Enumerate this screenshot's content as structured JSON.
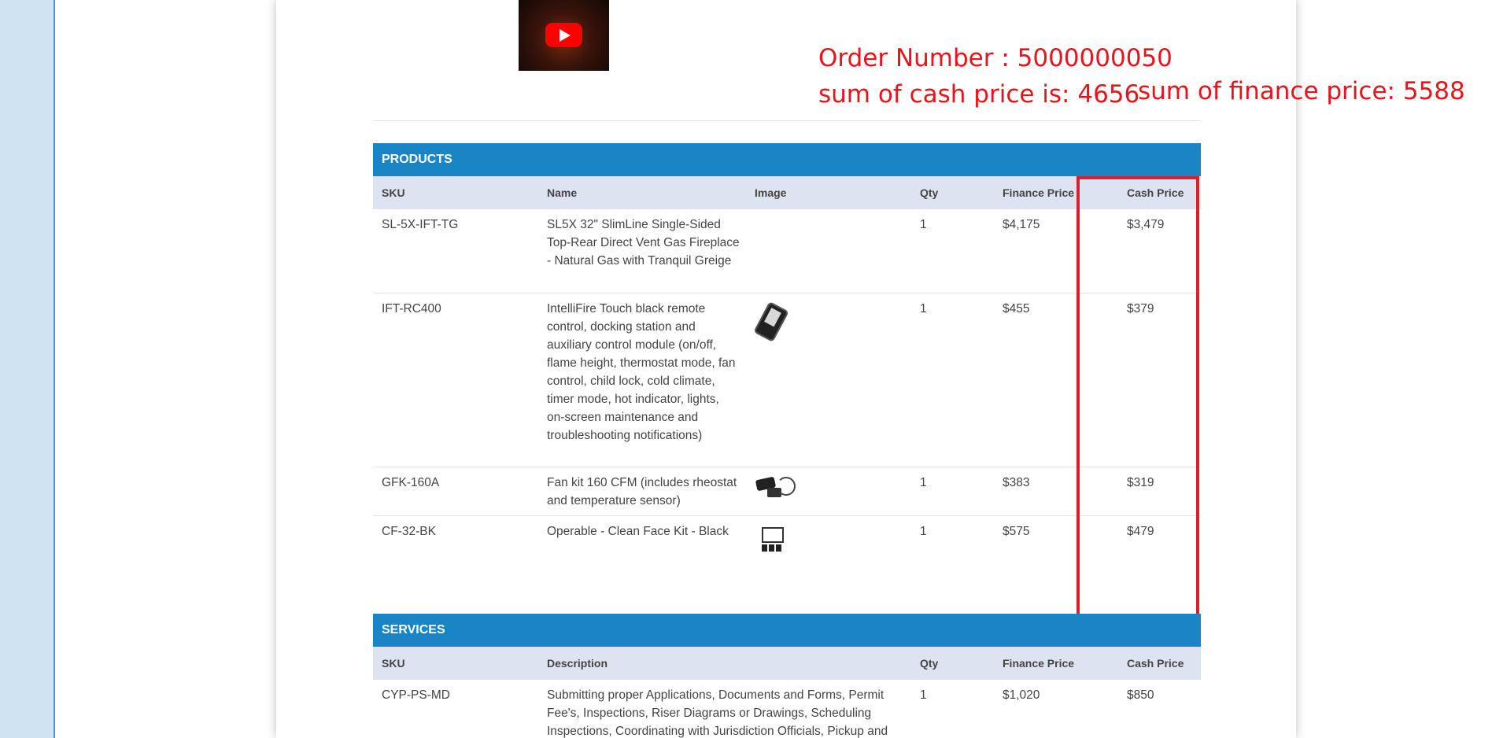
{
  "annotations": {
    "order_number": "Order Number : 5000000050",
    "cash_sum": "sum of cash price is: 4656",
    "finance_sum": "sum of finance price: 5588",
    "highlight_color": "#d9202c"
  },
  "video": {
    "icon": "youtube-play-icon"
  },
  "products": {
    "heading": "PRODUCTS",
    "columns": [
      "SKU",
      "Name",
      "Image",
      "Qty",
      "Finance Price",
      "Cash Price"
    ],
    "rows": [
      {
        "sku": "SL-5X-IFT-TG",
        "name": "SL5X 32\" SlimLine Single-Sided Top-Rear Direct Vent Gas Fireplace - Natural Gas with Tranquil Greige",
        "image": "",
        "qty": "1",
        "finance": "$4,175",
        "cash": "$3,479"
      },
      {
        "sku": "IFT-RC400",
        "name": "IntelliFire Touch black remote control, docking station and auxiliary control module (on/off, flame height, thermostat mode, fan control, child lock, cold climate, timer mode, hot indicator, lights, on-screen maintenance and troubleshooting notifications)",
        "image": "remote-control-image",
        "qty": "1",
        "finance": "$455",
        "cash": "$379"
      },
      {
        "sku": "GFK-160A",
        "name": "Fan kit 160 CFM (includes rheostat and temperature sensor)",
        "image": "fan-kit-image",
        "qty": "1",
        "finance": "$383",
        "cash": "$319"
      },
      {
        "sku": "CF-32-BK",
        "name": "Operable - Clean Face Kit - Black",
        "image": "clean-face-kit-image",
        "qty": "1",
        "finance": "$575",
        "cash": "$479"
      }
    ]
  },
  "services": {
    "heading": "SERVICES",
    "columns": [
      "SKU",
      "Description",
      "Qty",
      "Finance Price",
      "Cash Price"
    ],
    "rows": [
      {
        "sku": "CYP-PS-MD",
        "description": "Submitting proper Applications, Documents and Forms, Permit Fee's, Inspections, Riser Diagrams or Drawings, Scheduling Inspections, Coordinating with Jurisdiction Officials, Pickup and",
        "qty": "1",
        "finance": "$1,020",
        "cash": "$850"
      }
    ]
  },
  "colors": {
    "section_header": "#1a85c4",
    "column_header": "#dde3f0",
    "left_panel": "#cfe3f3",
    "annotation_text": "#e8141c"
  }
}
